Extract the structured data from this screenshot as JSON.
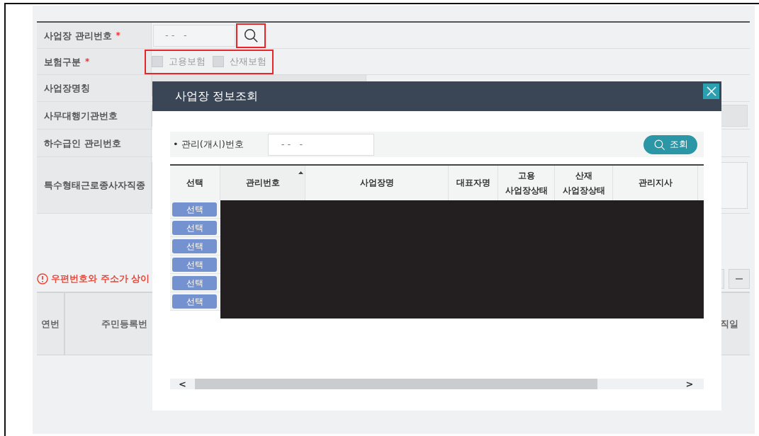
{
  "form": {
    "rows": [
      {
        "label": "사업장 관리번호",
        "required_mark": "*",
        "kind": "search",
        "value": "- -   -",
        "highlight": true
      },
      {
        "label": "보험구분",
        "required_mark": "*",
        "kind": "checks",
        "highlight": true,
        "options": [
          {
            "label": "고용보험",
            "checked": false
          },
          {
            "label": "산재보험",
            "checked": false
          }
        ]
      },
      {
        "label": "사업장명칭",
        "kind": "text"
      },
      {
        "label": "사무대행기관번호",
        "kind": "text"
      },
      {
        "label": "하수급인 관리번호",
        "kind": "none"
      },
      {
        "label": "특수형태근로종사자직종",
        "kind": "area"
      }
    ]
  },
  "warning": "우편번호와 주소가 상이",
  "lower_table": {
    "columns": [
      "연번",
      "주민등록번",
      "직일"
    ]
  },
  "modal": {
    "title": "사업장 정보조회",
    "search": {
      "bullet": "•",
      "label": "관리(개시)번호",
      "value": "- -   -",
      "button": "조회"
    },
    "columns": [
      {
        "label": "선택",
        "sorted": false
      },
      {
        "label": "관리번호",
        "sorted": true
      },
      {
        "label": "사업장명",
        "sorted": false
      },
      {
        "label": "대표자명",
        "sorted": false
      },
      {
        "label": "고용\n사업장상태",
        "sorted": false
      },
      {
        "label": "산재\n사업장상태",
        "sorted": false
      },
      {
        "label": "관리지사",
        "sorted": false
      }
    ],
    "rows": [
      "선택",
      "선택",
      "선택",
      "선택",
      "선택",
      "선택"
    ],
    "redacted": true,
    "scroll": {
      "left": "<",
      "right": ">"
    }
  }
}
